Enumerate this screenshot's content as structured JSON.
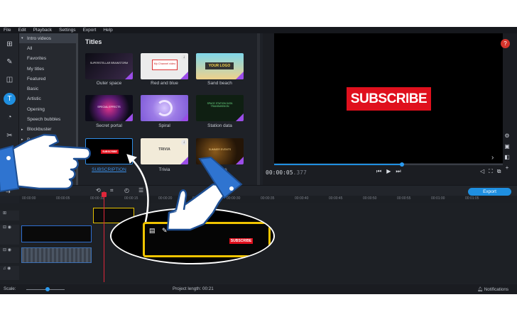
{
  "menu": [
    "File",
    "Edit",
    "Playback",
    "Settings",
    "Export",
    "Help"
  ],
  "categories": [
    {
      "label": "Intro videos",
      "arrow": "▾"
    },
    {
      "label": "All",
      "arrow": ""
    },
    {
      "label": "Favorites",
      "arrow": ""
    },
    {
      "label": "My titles",
      "arrow": ""
    },
    {
      "label": "Featured",
      "arrow": ""
    },
    {
      "label": "Basic",
      "arrow": ""
    },
    {
      "label": "Artistic",
      "arrow": ""
    },
    {
      "label": "Opening",
      "arrow": ""
    },
    {
      "label": "Speech bubbles",
      "arrow": ""
    },
    {
      "label": "Blockbuster",
      "arrow": "▸"
    },
    {
      "label": "Beauty v",
      "arrow": "▸"
    }
  ],
  "gallery": {
    "title": "Titles",
    "tiles": [
      {
        "label": "Outer space",
        "thumb_text": "SUPERSTELLAR BRAINSTORM"
      },
      {
        "label": "Red and blue",
        "thumb_text": "My Channel video"
      },
      {
        "label": "Sand beach",
        "thumb_text": "YOUR LOGO"
      },
      {
        "label": "Secret portal",
        "thumb_text": "SPECIAL EFFECTS"
      },
      {
        "label": "Spiral",
        "thumb_text": ""
      },
      {
        "label": "Station data",
        "thumb_text": "SPACE STATION DATA TRANSMISSION"
      },
      {
        "label": "SUBSCRIPTION",
        "thumb_text": "SUBSCRIBE"
      },
      {
        "label": "Trivia",
        "thumb_text": "TRIVIA"
      },
      {
        "label": "Sparks",
        "thumb_text": "SUMMER EVENTS"
      }
    ]
  },
  "preview": {
    "subscribe": "SUBSCRIBE",
    "timecode": "00:00:05",
    "timecode_ms": ".377",
    "progress": 0.56
  },
  "timeline": {
    "export_label": "Export",
    "ticks": [
      "00:00:00",
      "00:00:05",
      "00:00:10",
      "00:00:15",
      "00:00:20",
      "00:00:25",
      "00:00:30",
      "00:00:35",
      "00:00:40",
      "00:00:45",
      "00:00:50",
      "00:00:55",
      "00:01:00",
      "00:01:05"
    ],
    "zoom_subscribe": "SUBSCRIBE"
  },
  "status": {
    "scale_label": "Scale:",
    "project_length": "Project length: 00:21",
    "notifications": "Notifications"
  }
}
